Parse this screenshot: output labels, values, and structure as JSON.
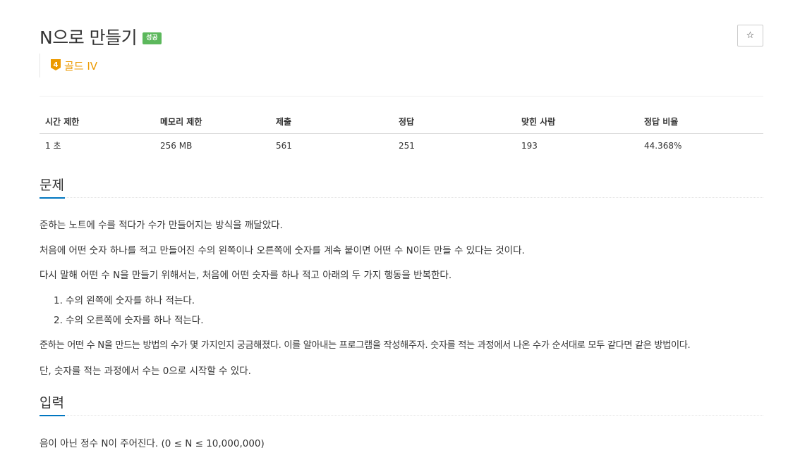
{
  "problem": {
    "title": "N으로 만들기",
    "status_badge": "성공",
    "tier_number": "4",
    "tier_label": "골드 IV",
    "tier_color": "#ec9a00",
    "badge_color": "#5cb85c",
    "star_icon": "☆"
  },
  "info_table": {
    "headers": [
      "시간 제한",
      "메모리 제한",
      "제출",
      "정답",
      "맞힌 사람",
      "정답 비율"
    ],
    "values": [
      "1 초",
      "256 MB",
      "561",
      "251",
      "193",
      "44.368%"
    ]
  },
  "description": {
    "heading": "문제",
    "paragraphs": [
      "준하는 노트에 수를 적다가 수가 만들어지는 방식을 깨달았다.",
      "처음에 어떤 숫자 하나를 적고 만들어진 수의 왼쪽이나 오른쪽에 숫자를 계속 붙이면 어떤 수 N이든 만들 수 있다는 것이다.",
      "다시 말해 어떤 수 N을 만들기 위해서는, 처음에 어떤 숫자를 하나 적고 아래의 두 가지 행동을 반복한다."
    ],
    "list": [
      "1. 수의 왼쪽에 숫자를 하나 적는다.",
      "2. 수의 오른쪽에 숫자를 하나 적는다."
    ],
    "paragraphs_after": [
      "준하는 어떤 수 N을 만드는 방법의 수가 몇 가지인지 궁금해졌다. 이를 알아내는 프로그램을 작성해주자. 숫자를 적는 과정에서 나온 수가 순서대로 모두 같다면 같은 방법이다.",
      "단, 숫자를 적는 과정에서 수는 0으로 시작할 수 있다."
    ]
  },
  "input_section": {
    "heading": "입력",
    "text": "음이 아닌 정수 N이 주어진다. (0 ≤ N ≤ 10,000,000)"
  }
}
